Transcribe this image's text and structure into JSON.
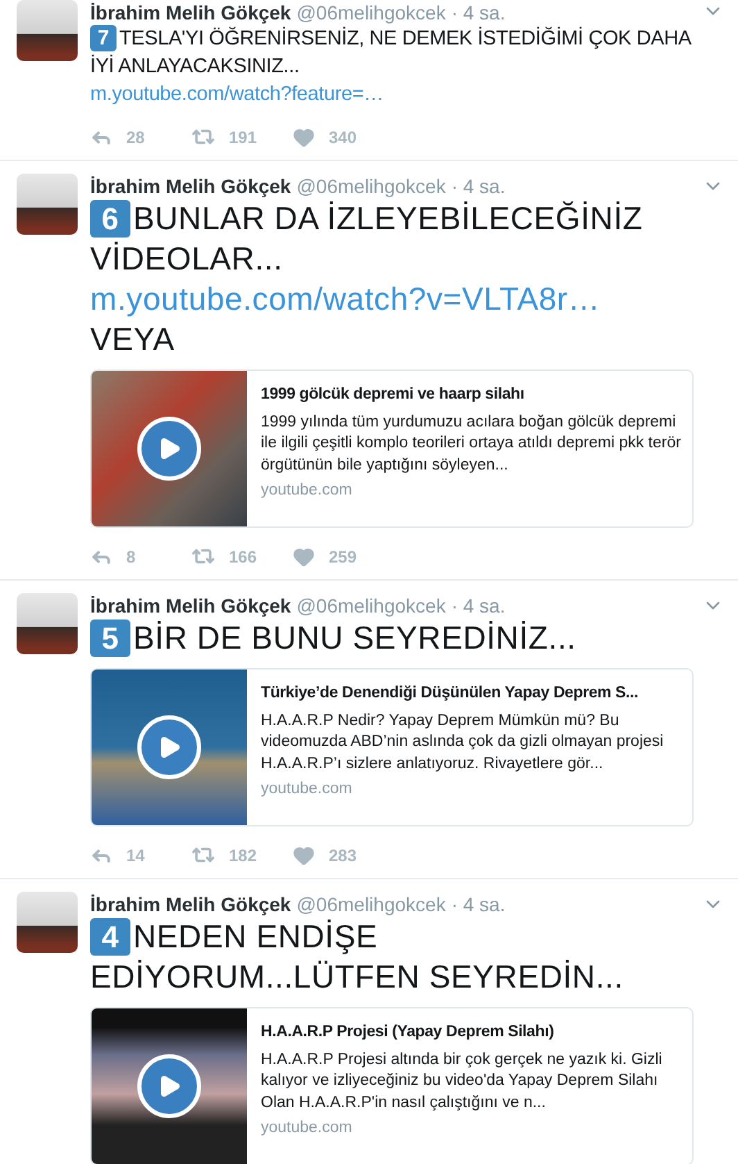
{
  "tweets": [
    {
      "author": "İbrahim Melih Gökçek",
      "handle": "@06melihgokcek",
      "time": "· 4 sa.",
      "number": "7",
      "kind": "normal",
      "parts": [
        {
          "kind": "text",
          "text": "TESLA'YI ÖĞRENİRSENİZ, NE DEMEK İSTEDİĞİMİ ÇOK DAHA İYİ ANLAYACAKSINIZ..."
        },
        {
          "kind": "link",
          "text": "m.youtube.com/watch?feature=…"
        }
      ],
      "actions": {
        "replies": "28",
        "retweets": "191",
        "likes": "340"
      }
    },
    {
      "author": "İbrahim Melih Gökçek",
      "handle": "@06melihgokcek",
      "time": "· 4 sa.",
      "number": "6",
      "kind": "large",
      "parts": [
        {
          "kind": "text",
          "text": "BUNLAR DA İZLEYEBİLECEĞİNİZ VİDEOLAR..."
        },
        {
          "kind": "link",
          "text": "m.youtube.com/watch?v=VLTA8r…"
        },
        {
          "kind": "text",
          "text": "VEYA"
        }
      ],
      "card": {
        "title": "1999 gölcük depremi ve haarp silahı",
        "description": "1999 yılında tüm yurdumuzu acılara boğan gölcük depremi ile ilgili çeşitli komplo teorileri ortaya atıldı depremi pkk terör örgütünün bile yaptığını söyleyen...",
        "domain": "youtube.com"
      },
      "actions": {
        "replies": "8",
        "retweets": "166",
        "likes": "259"
      }
    },
    {
      "author": "İbrahim Melih Gökçek",
      "handle": "@06melihgokcek",
      "time": "· 4 sa.",
      "number": "5",
      "kind": "large",
      "parts": [
        {
          "kind": "text",
          "text": "BİR DE BUNU SEYREDİNİZ..."
        }
      ],
      "card": {
        "title": "Türkiye’de Denendiği Düşünülen Yapay Deprem S...",
        "description": "H.A.A.R.P Nedir? Yapay Deprem Mümkün mü? Bu videomuzda ABD’nin aslında çok da gizli olmayan projesi H.A.A.R.P’ı sizlere anlatıyoruz. Rivayetlere gör...",
        "domain": "youtube.com"
      },
      "actions": {
        "replies": "14",
        "retweets": "182",
        "likes": "283"
      }
    },
    {
      "author": "İbrahim Melih Gökçek",
      "handle": "@06melihgokcek",
      "time": "· 4 sa.",
      "number": "4",
      "kind": "large",
      "parts": [
        {
          "kind": "text",
          "text": "NEDEN ENDİŞE EDİYORUM...LÜTFEN SEYREDİN..."
        }
      ],
      "card": {
        "title": "H.A.A.R.P Projesi (Yapay Deprem Silahı)",
        "description": "H.A.A.R.P Projesi altında bir çok gerçek ne yazık ki. Gizli kalıyor ve izliyeceğiniz bu video'da Yapay Deprem Silahı Olan H.A.A.R.P'in nasıl çalıştığını ve n...",
        "domain": "youtube.com"
      }
    }
  ]
}
